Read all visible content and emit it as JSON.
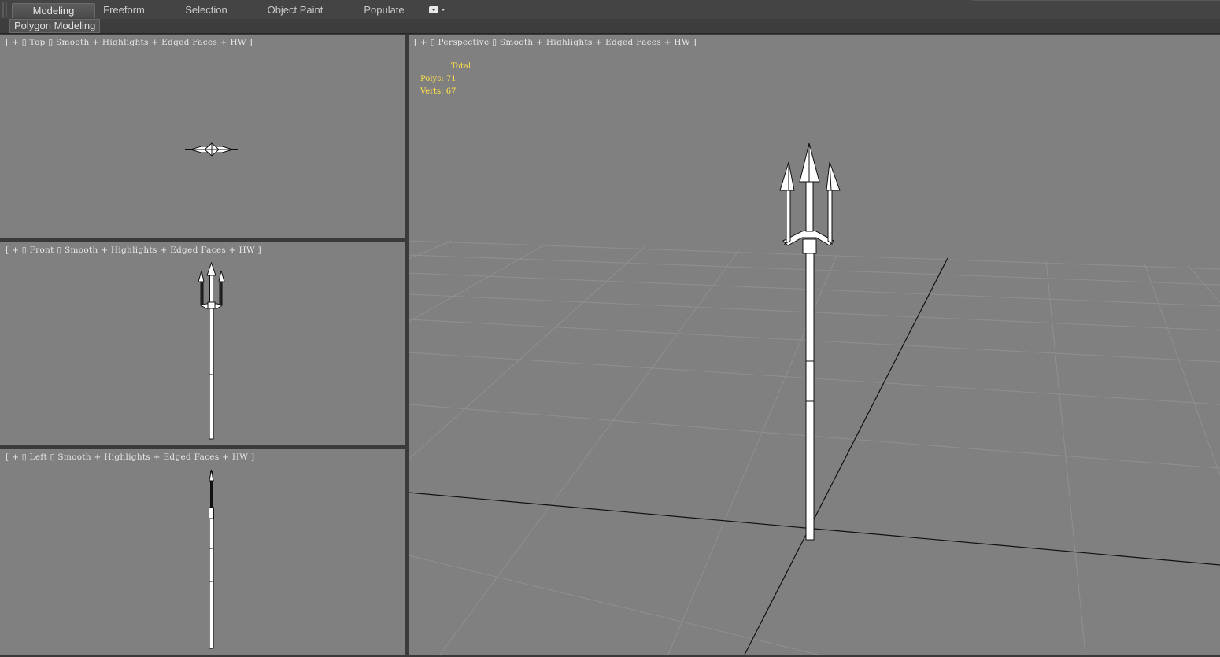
{
  "ribbon": {
    "tabs": [
      {
        "label": "Modeling",
        "active": true
      },
      {
        "label": "Freeform",
        "active": false
      },
      {
        "label": "Selection",
        "active": false
      },
      {
        "label": "Object Paint",
        "active": false
      },
      {
        "label": "Populate",
        "active": false
      }
    ],
    "sub_label": "Polygon Modeling"
  },
  "viewports": {
    "top": {
      "label": "[ + ▯ Top ▯ Smooth + Highlights + Edged Faces + HW ]"
    },
    "front": {
      "label": "[ + ▯ Front ▯ Smooth + Highlights + Edged Faces + HW ]"
    },
    "left": {
      "label": "[ + ▯ Left ▯ Smooth + Highlights + Edged Faces + HW ]"
    },
    "perspective": {
      "label": "[ + ▯ Perspective ▯ Smooth + Highlights + Edged Faces + HW ]"
    }
  },
  "stats": {
    "total_label": "Total",
    "polys": "Polys: 71",
    "verts": "Verts: 67"
  },
  "colors": {
    "viewport_bg": "#808080",
    "stats_text": "#ffe14a",
    "grid": "#8e8e8e"
  }
}
